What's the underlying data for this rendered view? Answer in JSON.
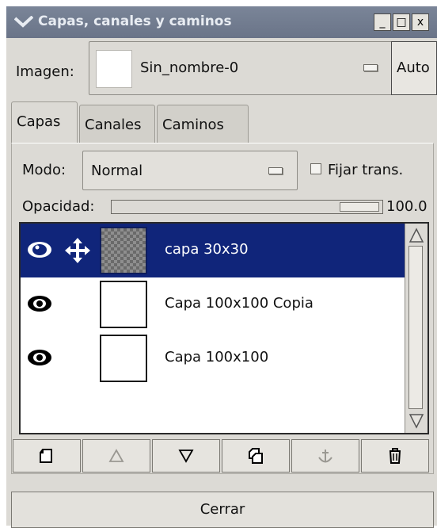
{
  "window": {
    "title": "Capas, canales y caminos",
    "minimize": "_",
    "maximize": "□",
    "close": "x"
  },
  "image_selector": {
    "label": "Imagen:",
    "value": "Sin_nombre-0",
    "auto_label": "Auto"
  },
  "tabs": [
    {
      "label": "Capas",
      "active": true
    },
    {
      "label": "Canales",
      "active": false
    },
    {
      "label": "Caminos",
      "active": false
    }
  ],
  "mode": {
    "label": "Modo:",
    "value": "Normal"
  },
  "lock": {
    "label": "Fijar trans.",
    "checked": false
  },
  "opacity": {
    "label": "Opacidad:",
    "value": "100.0",
    "fraction": 1.0
  },
  "layers": [
    {
      "name": "capa 30x30",
      "visible": true,
      "linked": true,
      "selected": true
    },
    {
      "name": "Capa 100x100 Copia",
      "visible": true,
      "linked": false,
      "selected": false
    },
    {
      "name": "Capa 100x100",
      "visible": true,
      "linked": false,
      "selected": false
    }
  ],
  "toolbar_icons": [
    "new-layer-icon",
    "raise-layer-icon",
    "lower-layer-icon",
    "duplicate-layer-icon",
    "anchor-layer-icon",
    "delete-layer-icon"
  ],
  "close_button": "Cerrar",
  "colors": {
    "selection": "#10257a",
    "titlebar": "#6a7488",
    "background": "#dcdad5"
  }
}
